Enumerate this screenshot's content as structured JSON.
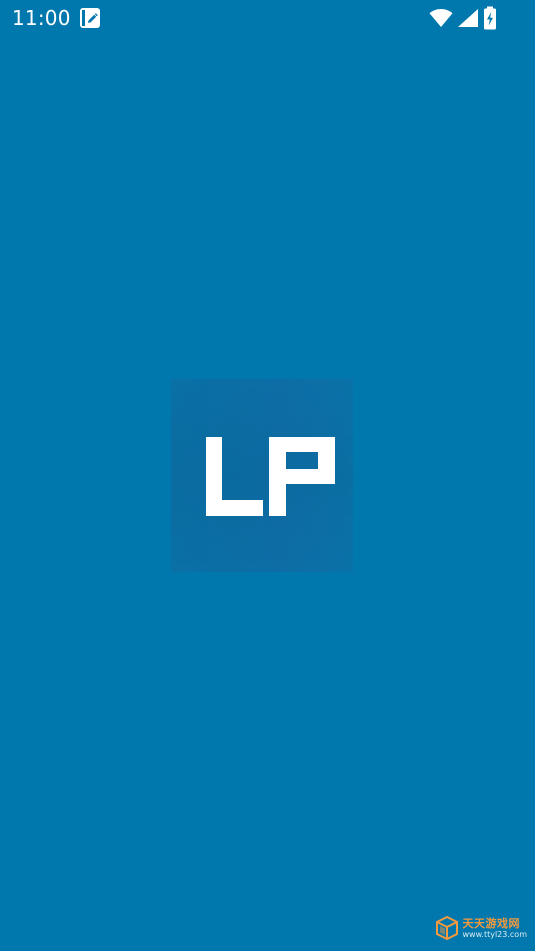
{
  "status_bar": {
    "time": "11:00",
    "icons": [
      "notification-edit-icon",
      "wifi-icon",
      "cellular-signal-icon",
      "battery-charging-icon"
    ]
  },
  "splash": {
    "logo_text": "LP",
    "background_color": "#0078ad",
    "logo_text_color": "#ffffff"
  },
  "watermark": {
    "title": "天天游戏网",
    "url": "www.ttyl23.com",
    "icon": "cube-logo-icon",
    "title_color": "#f39a3f"
  }
}
